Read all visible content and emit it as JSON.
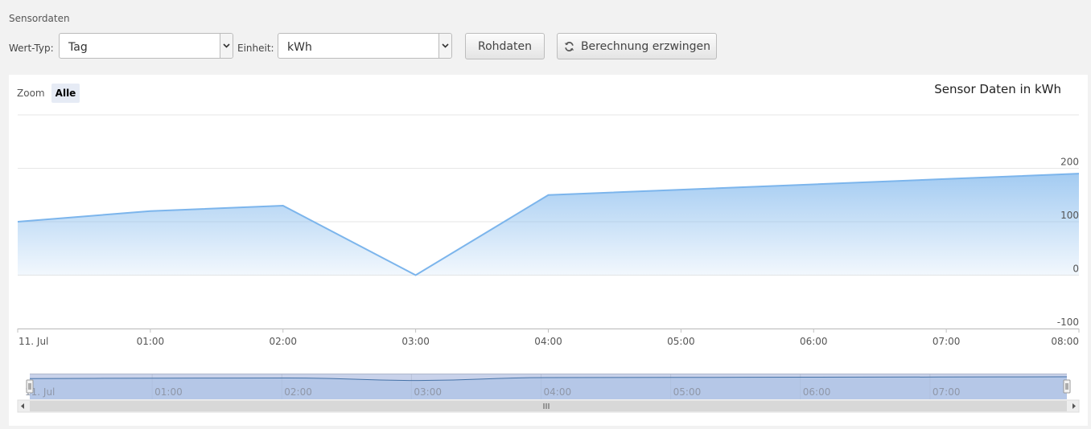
{
  "section_title": "Sensordaten",
  "toolbar": {
    "wert_typ_label": "Wert-Typ:",
    "wert_typ_value": "Tag",
    "einheit_label": "Einheit:",
    "einheit_value": "kWh",
    "rohdaten_label": "Rohdaten",
    "berechnung_label": "Berechnung erzwingen",
    "berechnung_icon": "refresh-icon"
  },
  "zoom": {
    "label": "Zoom",
    "option": "Alle"
  },
  "colors": {
    "line": "#7cb5ec",
    "navigator_line": "#4572a7",
    "navigator_mask": "#c9d2ea"
  },
  "chart_data": {
    "type": "area",
    "title": "Sensor Daten in kWh",
    "x": [
      "11. Jul",
      "01:00",
      "02:00",
      "03:00",
      "04:00",
      "05:00",
      "06:00",
      "07:00",
      "08:00"
    ],
    "series": [
      {
        "values": [
          100,
          120,
          130,
          0,
          150,
          160,
          170,
          180,
          190
        ]
      }
    ],
    "y_ticks": [
      "200",
      "100",
      "0",
      "-100"
    ],
    "ylim": [
      -100,
      300
    ],
    "navigator_ticks": [
      "11. Jul",
      "01:00",
      "02:00",
      "03:00",
      "04:00",
      "05:00",
      "06:00",
      "07:00"
    ],
    "grid": true,
    "y_axis_side": "right"
  }
}
